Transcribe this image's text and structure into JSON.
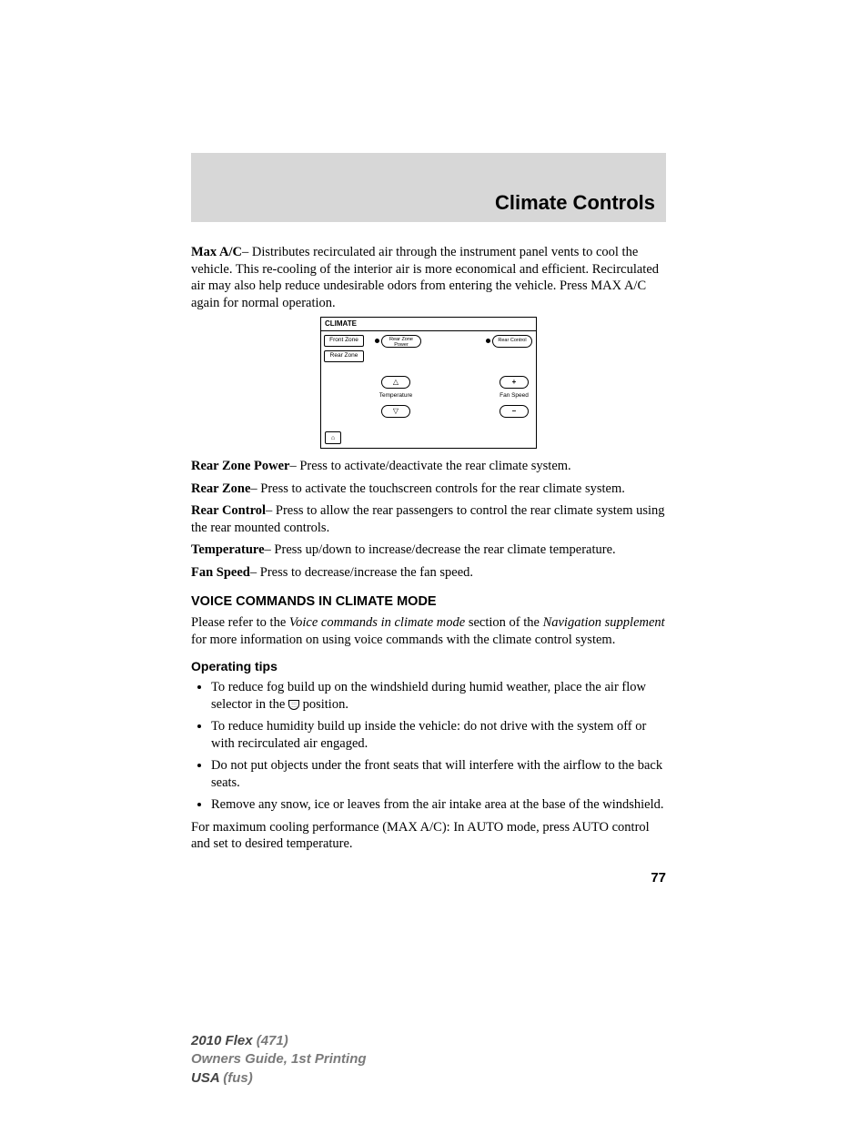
{
  "header": {
    "title": "Climate Controls"
  },
  "paragraphs": {
    "maxac_label": "Max A/C",
    "maxac_text": "– Distributes recirculated air through the instrument panel vents to cool the vehicle. This re-cooling of the interior air is more economical and efficient. Recirculated air may also help reduce undesirable odors from entering the vehicle. Press MAX A/C again for normal operation.",
    "rzp_label": "Rear Zone Power",
    "rzp_text": "– Press to activate/deactivate the rear climate system.",
    "rz_label": "Rear Zone",
    "rz_text": "– Press to activate the touchscreen controls for the rear climate system.",
    "rc_label": "Rear Control",
    "rc_text": "– Press to allow the rear passengers to control the rear climate system using the rear mounted controls.",
    "temp_label": "Temperature",
    "temp_text": "– Press up/down to increase/decrease the rear climate temperature.",
    "fan_label": "Fan Speed",
    "fan_text": "– Press to decrease/increase the fan speed."
  },
  "voice": {
    "heading": "VOICE COMMANDS IN CLIMATE MODE",
    "pre": "Please refer to the ",
    "ital1": "Voice commands in climate mode",
    "mid": " section of the ",
    "ital2": "Navigation supplement",
    "post": " for more information on using voice commands with the climate control system."
  },
  "tips": {
    "heading": "Operating tips",
    "items": [
      {
        "pre": "To reduce fog build up on the windshield during humid weather, place the air flow selector in the ",
        "post": " position."
      },
      {
        "pre": "To reduce humidity build up inside the vehicle: do not drive with the system off or with recirculated air engaged.",
        "post": ""
      },
      {
        "pre": "Do not put objects under the front seats that will interfere with the airflow to the back seats.",
        "post": ""
      },
      {
        "pre": "Remove any snow, ice or leaves from the air intake area at the base of the windshield.",
        "post": ""
      }
    ],
    "closing": "For maximum cooling performance (MAX A/C): In AUTO mode, press AUTO control and set to desired temperature."
  },
  "diagram": {
    "title": "CLIMATE",
    "front_zone": "Front Zone",
    "rear_zone": "Rear Zone",
    "rear_zone_power": "Rear Zone Power",
    "rear_control": "Rear Control",
    "temperature": "Temperature",
    "fan_speed": "Fan Speed",
    "plus": "+",
    "minus": "–",
    "home": "⌂"
  },
  "page_number": "77",
  "footer": {
    "l1a": "2010 Flex ",
    "l1b": "(471)",
    "l2": "Owners Guide, 1st Printing",
    "l3a": "USA ",
    "l3b": "(fus)"
  }
}
